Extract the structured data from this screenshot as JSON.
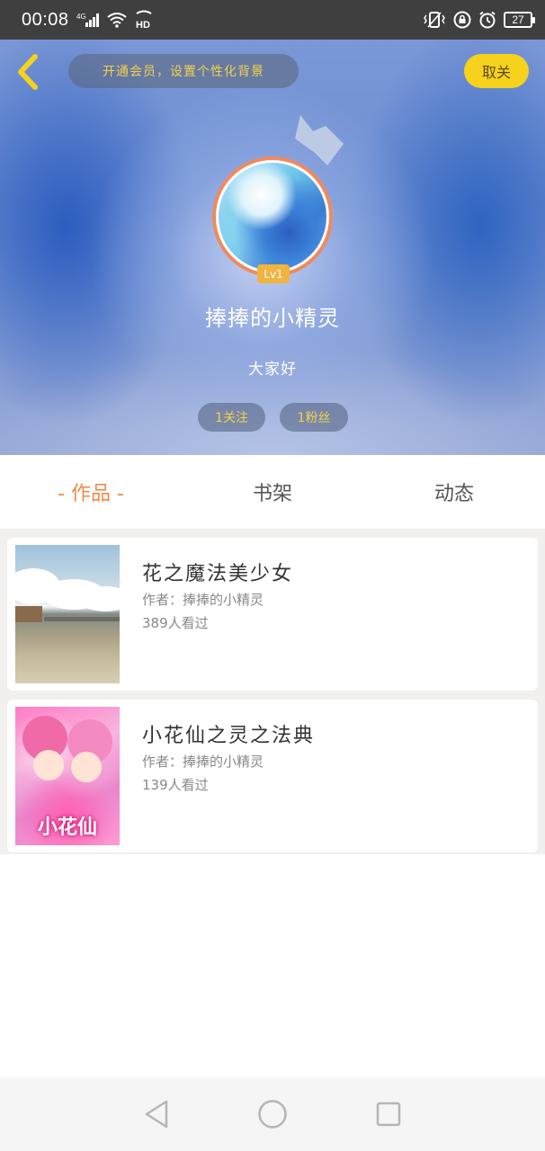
{
  "status_bar": {
    "time": "00:08",
    "network": "4G",
    "hd_label": "HD",
    "battery": "27"
  },
  "header": {
    "vip_banner": "开通会员，设置个性化背景",
    "cancel_label": "取关",
    "level": "Lv1",
    "username": "捧捧的小精灵",
    "bio": "大家好",
    "follow_count": "1关注",
    "fans_count": "1粉丝"
  },
  "tabs": [
    {
      "label": "- 作品 -",
      "active": true
    },
    {
      "label": "书架",
      "active": false
    },
    {
      "label": "动态",
      "active": false
    }
  ],
  "works": [
    {
      "title": "花之魔法美少女",
      "author": "作者：捧捧的小精灵",
      "views": "389人看过"
    },
    {
      "title": "小花仙之灵之法典",
      "author": "作者：捧捧的小精灵",
      "views": "139人看过"
    }
  ],
  "cover_2_logo": "小花仙",
  "colors": {
    "accent_orange": "#f08a48",
    "vip_yellow": "#f3d24a",
    "cancel_button": "#f6d21c",
    "level_badge": "#f2b33f"
  },
  "icons": {
    "back": "chevron-left-icon",
    "crown": "crown-icon",
    "nav_back": "triangle-back-icon",
    "nav_home": "circle-home-icon",
    "nav_recent": "square-recent-icon"
  }
}
